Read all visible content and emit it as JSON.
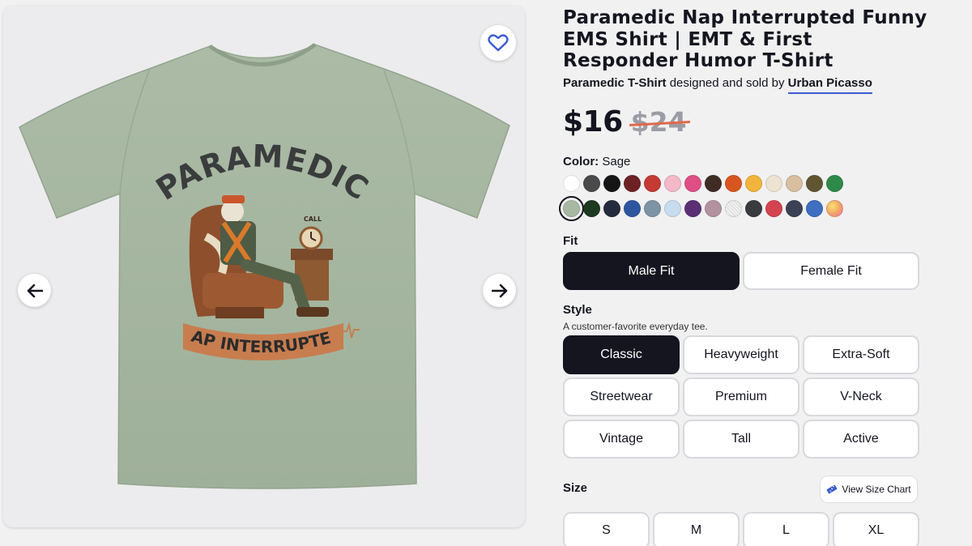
{
  "product": {
    "title": "Paramedic Nap Interrupted Funny EMS Shirt | EMT & First Responder Humor T-Shirt",
    "type": "Paramedic T-Shirt",
    "byline_mid": "designed and sold by",
    "artist": "Urban Picasso",
    "price": "$16",
    "old_price": "$24"
  },
  "artwork": {
    "top_text": "PARAMEDIC",
    "banner_text": "NAP INTERRUPTED.",
    "clock_text": "CALL"
  },
  "color": {
    "label": "Color:",
    "selected": "Sage",
    "swatches": [
      {
        "name": "white",
        "hex": "#ffffff"
      },
      {
        "name": "charcoal",
        "hex": "#4a4a4c"
      },
      {
        "name": "black",
        "hex": "#151515"
      },
      {
        "name": "maroon",
        "hex": "#6e2226"
      },
      {
        "name": "red",
        "hex": "#c43a35"
      },
      {
        "name": "light-pink",
        "hex": "#f3b9c9"
      },
      {
        "name": "pink",
        "hex": "#df4f86"
      },
      {
        "name": "brown",
        "hex": "#3f2d25"
      },
      {
        "name": "orange",
        "hex": "#d9551f"
      },
      {
        "name": "gold",
        "hex": "#f2b43b"
      },
      {
        "name": "natural",
        "hex": "#ece3d1"
      },
      {
        "name": "tan",
        "hex": "#d8bf9f"
      },
      {
        "name": "olive",
        "hex": "#5f5631"
      },
      {
        "name": "kelly-green",
        "hex": "#2f8a4a"
      },
      {
        "name": "sage",
        "hex": "#a8b9a3"
      },
      {
        "name": "forest",
        "hex": "#1d3a20"
      },
      {
        "name": "navy",
        "hex": "#242b3c"
      },
      {
        "name": "royal",
        "hex": "#2e56a0"
      },
      {
        "name": "slate-blue",
        "hex": "#7d93a6"
      },
      {
        "name": "light-blue",
        "hex": "#c8dcf0"
      },
      {
        "name": "purple",
        "hex": "#5a2f74"
      },
      {
        "name": "mauve",
        "hex": "#b2929f"
      },
      {
        "name": "heather-white",
        "hex": "#e6e6e6"
      },
      {
        "name": "dark-heather",
        "hex": "#3a3b3f"
      },
      {
        "name": "heather-red",
        "hex": "#d3444f"
      },
      {
        "name": "heather-navy",
        "hex": "#3b4256"
      },
      {
        "name": "heather-blue",
        "hex": "#3e6fc0"
      },
      {
        "name": "tie-dye",
        "hex": "#f4b07a"
      }
    ]
  },
  "fit": {
    "label": "Fit",
    "options": [
      "Male Fit",
      "Female Fit"
    ],
    "selected": "Male Fit"
  },
  "style": {
    "label": "Style",
    "description": "A customer-favorite everyday tee.",
    "options": [
      "Classic",
      "Heavyweight",
      "Extra-Soft",
      "Streetwear",
      "Premium",
      "V-Neck",
      "Vintage",
      "Tall",
      "Active"
    ],
    "selected": "Classic"
  },
  "size": {
    "label": "Size",
    "chart_label": "View Size Chart",
    "options": [
      "S",
      "M",
      "L",
      "XL"
    ]
  },
  "icons": {
    "favorite": "heart-icon",
    "prev": "arrow-left-icon",
    "next": "arrow-right-icon",
    "size_chart": "ruler-icon"
  },
  "colors": {
    "accent": "#3a5bd0",
    "dark": "#14151f",
    "strike": "#e0694a",
    "shirt": "#a6b6a0"
  }
}
